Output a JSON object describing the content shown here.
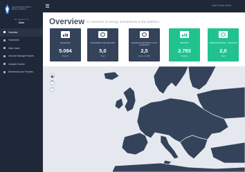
{
  "sidebar": {
    "brand_text": "Data Exchange Platform\nEfficiency Platform",
    "user_caption": "Be logged in as",
    "user_name": "User",
    "items": [
      {
        "label": "Overview",
        "active": true,
        "icon": "home-icon"
      },
      {
        "label": "Factsheets",
        "icon": "document-icon"
      },
      {
        "label": "Main charts",
        "icon": "chart-icon"
      },
      {
        "label": "Add and Manage Projects",
        "icon": "folder-icon"
      },
      {
        "label": "Analysis Toolbox",
        "icon": "wrench-icon"
      },
      {
        "label": "Benchmark your Projects",
        "icon": "gauge-icon"
      }
    ]
  },
  "topbar": {
    "menu_icon": "hamburger-icon",
    "right_text": "Data Privacy Terms"
  },
  "header": {
    "title": "Overview",
    "subtitle": "An overview of energy investments in the platform"
  },
  "cards": [
    {
      "label": "Buildings",
      "value": "5.094",
      "unit": "Projects",
      "theme": "dark",
      "icon": "bar-chart-icon"
    },
    {
      "label": "Investment Per Building",
      "value": "5,0",
      "unit": "Years",
      "theme": "dark",
      "icon": "money-icon"
    },
    {
      "label": "Average Investment Cost Buildings",
      "value": "2,5",
      "unit": "Euros per kWh",
      "theme": "dark",
      "icon": "money-icon"
    },
    {
      "label": "Industry",
      "value": "2.783",
      "unit": "Projects",
      "theme": "green",
      "icon": "bar-chart-icon"
    },
    {
      "label": "Average Payback - Industry",
      "value": "2,0",
      "unit": "Years",
      "theme": "green",
      "icon": "money-icon"
    }
  ],
  "map": {
    "zoom_in": "+",
    "zoom_out": "−",
    "home_icon": "home-icon"
  },
  "colors": {
    "sidebar_bg": "#1e2838",
    "card_dark": "#34435a",
    "card_green": "#22c28f",
    "land": "#34435a",
    "sea": "#e5e9ef"
  }
}
